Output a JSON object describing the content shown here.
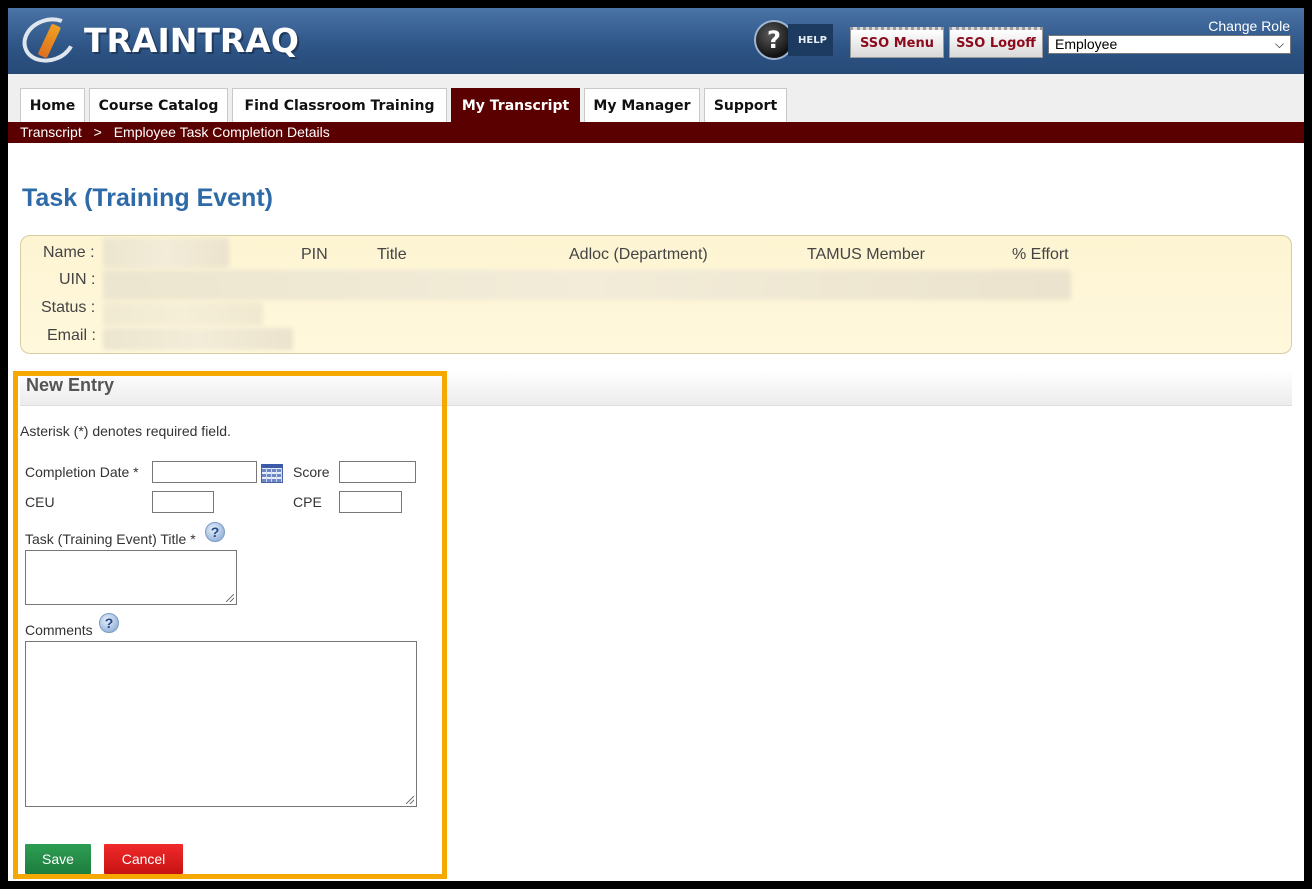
{
  "header": {
    "logo_text": "TRAINTRAQ",
    "help_label": "HELP",
    "help_glyph": "?",
    "sso_menu_label": "SSO Menu",
    "sso_logoff_label": "SSO Logoff",
    "change_role_label": "Change Role",
    "role_selected": "Employee"
  },
  "tabs": [
    {
      "label": "Home"
    },
    {
      "label": "Course Catalog"
    },
    {
      "label": "Find Classroom Training"
    },
    {
      "label": "My Transcript",
      "active": true
    },
    {
      "label": "My Manager"
    },
    {
      "label": "Support"
    }
  ],
  "breadcrumb": {
    "root": "Transcript",
    "separator": ">",
    "current": "Employee Task Completion Details"
  },
  "page_title": "Task (Training Event)",
  "employee_info": {
    "labels": {
      "name": "Name :",
      "uin": "UIN :",
      "status": "Status :",
      "email": "Email :"
    },
    "columns": [
      "PIN",
      "Title",
      "Adloc (Department)",
      "TAMUS Member",
      "% Effort"
    ]
  },
  "new_entry": {
    "title": "New Entry",
    "required_note": "Asterisk (*) denotes required field.",
    "completion_date_label": "Completion Date *",
    "score_label": "Score",
    "ceu_label": "CEU",
    "cpe_label": "CPE",
    "task_title_label": "Task (Training Event) Title *",
    "comments_label": "Comments",
    "completion_date_value": "",
    "score_value": "",
    "ceu_value": "",
    "cpe_value": "",
    "save_label": "Save",
    "cancel_label": "Cancel"
  },
  "colors": {
    "header_blue": "#2d5485",
    "tab_active": "#5a0000",
    "title_blue": "#2e6aa8",
    "highlight": "#f5a800",
    "save_green": "#1d7d3d",
    "cancel_red": "#e01818"
  }
}
